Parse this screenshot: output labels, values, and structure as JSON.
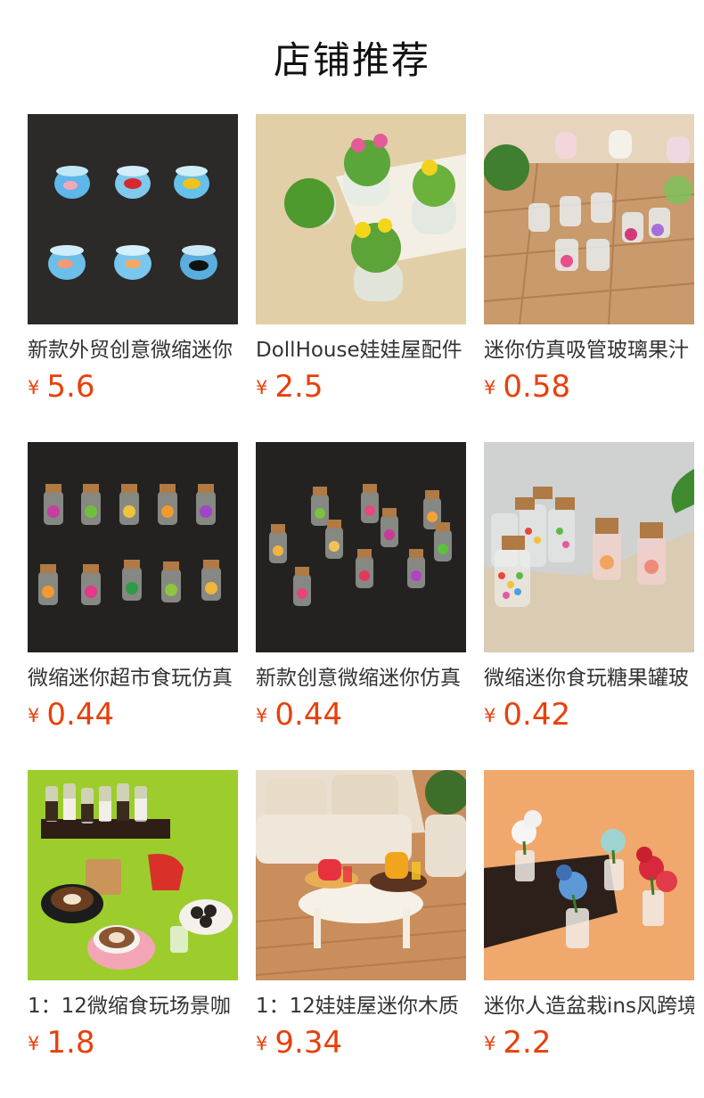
{
  "header": {
    "title": "店铺推荐"
  },
  "currency": "¥",
  "products": [
    {
      "title": "新款外贸创意微缩迷你",
      "price": "5.6",
      "image": "goldfish-bowls"
    },
    {
      "title": "DollHouse娃娃屋配件",
      "price": "2.5",
      "image": "potted-plants"
    },
    {
      "title": "迷你仿真吸管玻璃果汁",
      "price": "0.58",
      "image": "straw-jars"
    },
    {
      "title": "微缩迷你超市食玩仿真",
      "price": "0.44",
      "image": "cork-jars-black"
    },
    {
      "title": "新款创意微缩迷你仿真",
      "price": "0.44",
      "image": "cork-jars-scattered"
    },
    {
      "title": "微缩迷你食玩糖果罐玻",
      "price": "0.42",
      "image": "candy-jars"
    },
    {
      "title": "1：12微缩食玩场景咖",
      "price": "1.8",
      "image": "coffee-scene"
    },
    {
      "title": "1：12娃娃屋迷你木质",
      "price": "9.34",
      "image": "dollhouse-table"
    },
    {
      "title": "迷你人造盆栽ins风跨境",
      "price": "2.2",
      "image": "flower-vases"
    }
  ]
}
